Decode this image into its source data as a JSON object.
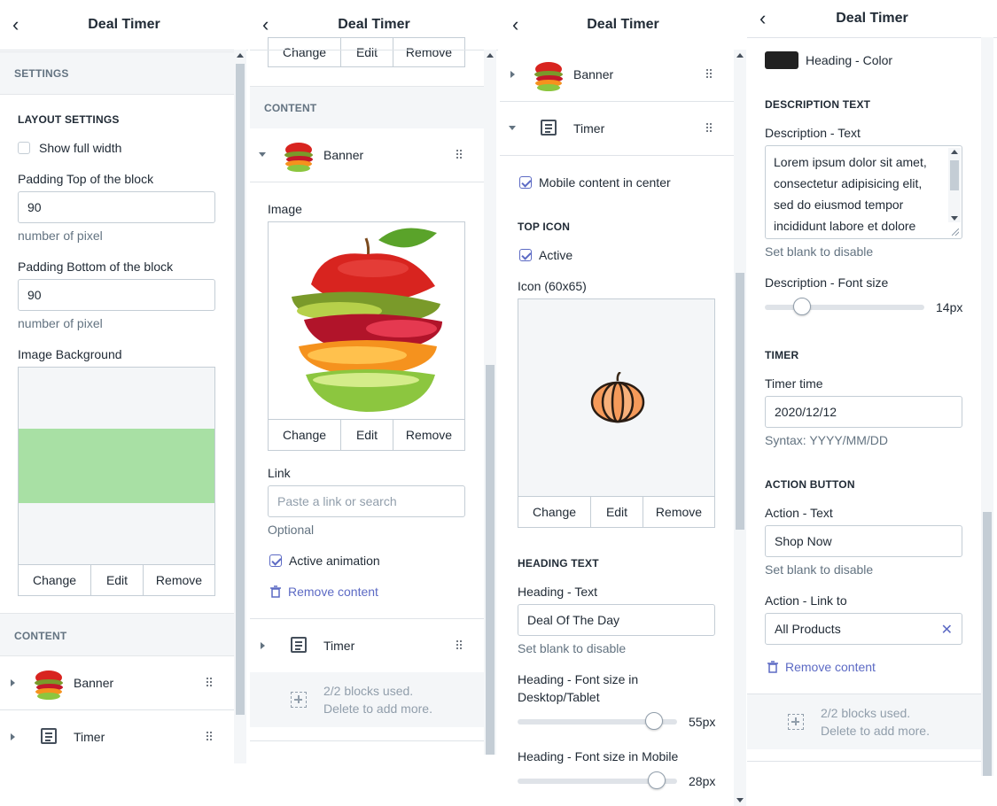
{
  "app_title": "Deal Timer",
  "panel1": {
    "section": "SETTINGS",
    "layout_heading": "LAYOUT SETTINGS",
    "show_full_width": "Show full width",
    "padding_top_label": "Padding Top of the block",
    "padding_top_value": "90",
    "padding_help": "number of pixel",
    "padding_bottom_label": "Padding Bottom of the block",
    "padding_bottom_value": "90",
    "image_bg_label": "Image Background",
    "buttons": [
      "Change",
      "Edit",
      "Remove"
    ],
    "content_section": "CONTENT",
    "blocks": [
      "Banner",
      "Timer"
    ]
  },
  "panel2": {
    "top_buttons": [
      "Change",
      "Edit",
      "Remove"
    ],
    "content_section": "CONTENT",
    "banner_block": "Banner",
    "image_label": "Image",
    "buttons": [
      "Change",
      "Edit",
      "Remove"
    ],
    "link_label": "Link",
    "link_placeholder": "Paste a link or search",
    "optional": "Optional",
    "active_animation": "Active animation",
    "remove_content": "Remove content",
    "timer_block": "Timer",
    "blocks_used": "2/2 blocks used.",
    "delete_more": "Delete to add more."
  },
  "panel3": {
    "banner_block": "Banner",
    "timer_block": "Timer",
    "mobile_center": "Mobile content in center",
    "top_icon_heading": "TOP ICON",
    "active": "Active",
    "icon_label": "Icon (60x65)",
    "buttons": [
      "Change",
      "Edit",
      "Remove"
    ],
    "heading_text_heading": "HEADING TEXT",
    "heading_text_label": "Heading - Text",
    "heading_text_value": "Deal Of The Day",
    "set_blank": "Set blank to disable",
    "font_desktop_label_1": "Heading - Font size in",
    "font_desktop_label_2": "Desktop/Tablet",
    "font_desktop_value": "55px",
    "font_desktop_level": 0.9,
    "font_mobile_label": "Heading - Font size in Mobile",
    "font_mobile_value": "28px",
    "font_mobile_level": 0.92
  },
  "panel4": {
    "heading_color_label": "Heading - Color",
    "heading_color": "#212121",
    "desc_heading": "DESCRIPTION TEXT",
    "desc_text_label": "Description - Text",
    "desc_lines": [
      "Lorem ipsum dolor sit amet,",
      "consectetur adipisicing elit,",
      "sed do eiusmod tempor",
      "incididunt labore et dolore"
    ],
    "set_blank": "Set blank to disable",
    "desc_font_label": "Description - Font size",
    "desc_font_value": "14px",
    "desc_font_level": 0.2,
    "timer_heading": "TIMER",
    "timer_time_label": "Timer time",
    "timer_time_value": "2020/12/12",
    "syntax": "Syntax: YYYY/MM/DD",
    "action_heading": "ACTION BUTTON",
    "action_text_label": "Action - Text",
    "action_text_value": "Shop Now",
    "action_link_label": "Action - Link to",
    "action_link_value": "All Products",
    "remove_content": "Remove content",
    "blocks_used": "2/2 blocks used.",
    "delete_more": "Delete to add more."
  },
  "colors": {
    "accent": "#5c6ac4",
    "green_overlay": "#a8e0a4",
    "border": "#c4cdd5"
  }
}
